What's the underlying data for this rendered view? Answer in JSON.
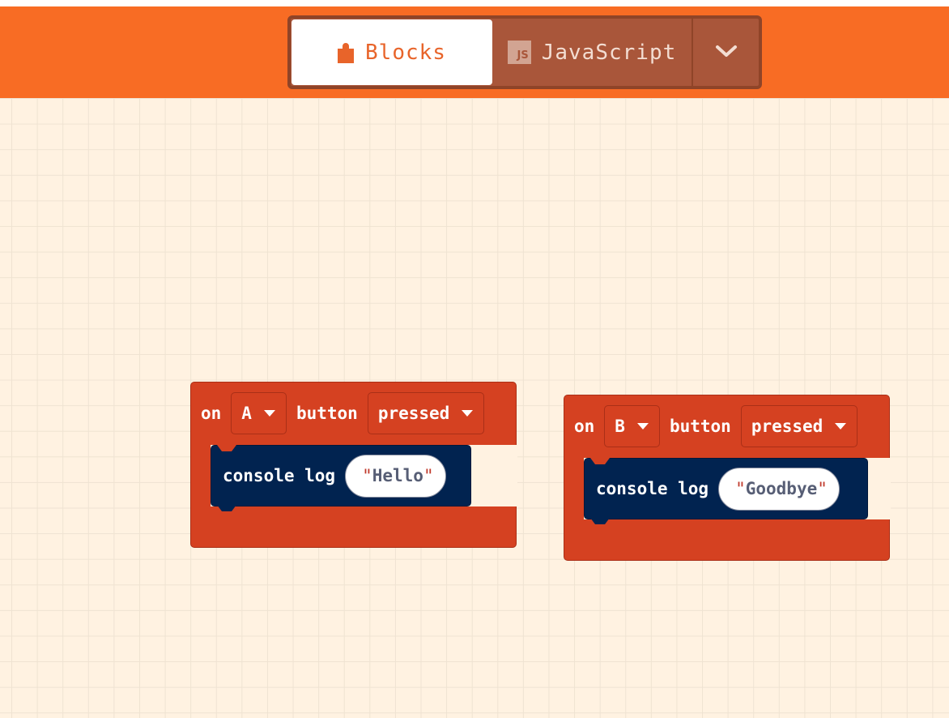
{
  "header": {
    "tabs": {
      "blocks_label": "Blocks",
      "javascript_label": "JavaScript",
      "js_badge": "JS"
    },
    "active_tab": "Blocks",
    "colors": {
      "header": "#f86c24",
      "event_block": "#d54121",
      "command_block": "#012350",
      "workspace": "#fff2e1"
    }
  },
  "workspace": {
    "blocks": [
      {
        "on": "on",
        "button_value": "A",
        "button_word": "button",
        "event_value": "pressed",
        "command": "console log",
        "string_value": "Hello",
        "quote": "\""
      },
      {
        "on": "on",
        "button_value": "B",
        "button_word": "button",
        "event_value": "pressed",
        "command": "console log",
        "string_value": "Goodbye",
        "quote": "\""
      }
    ]
  }
}
